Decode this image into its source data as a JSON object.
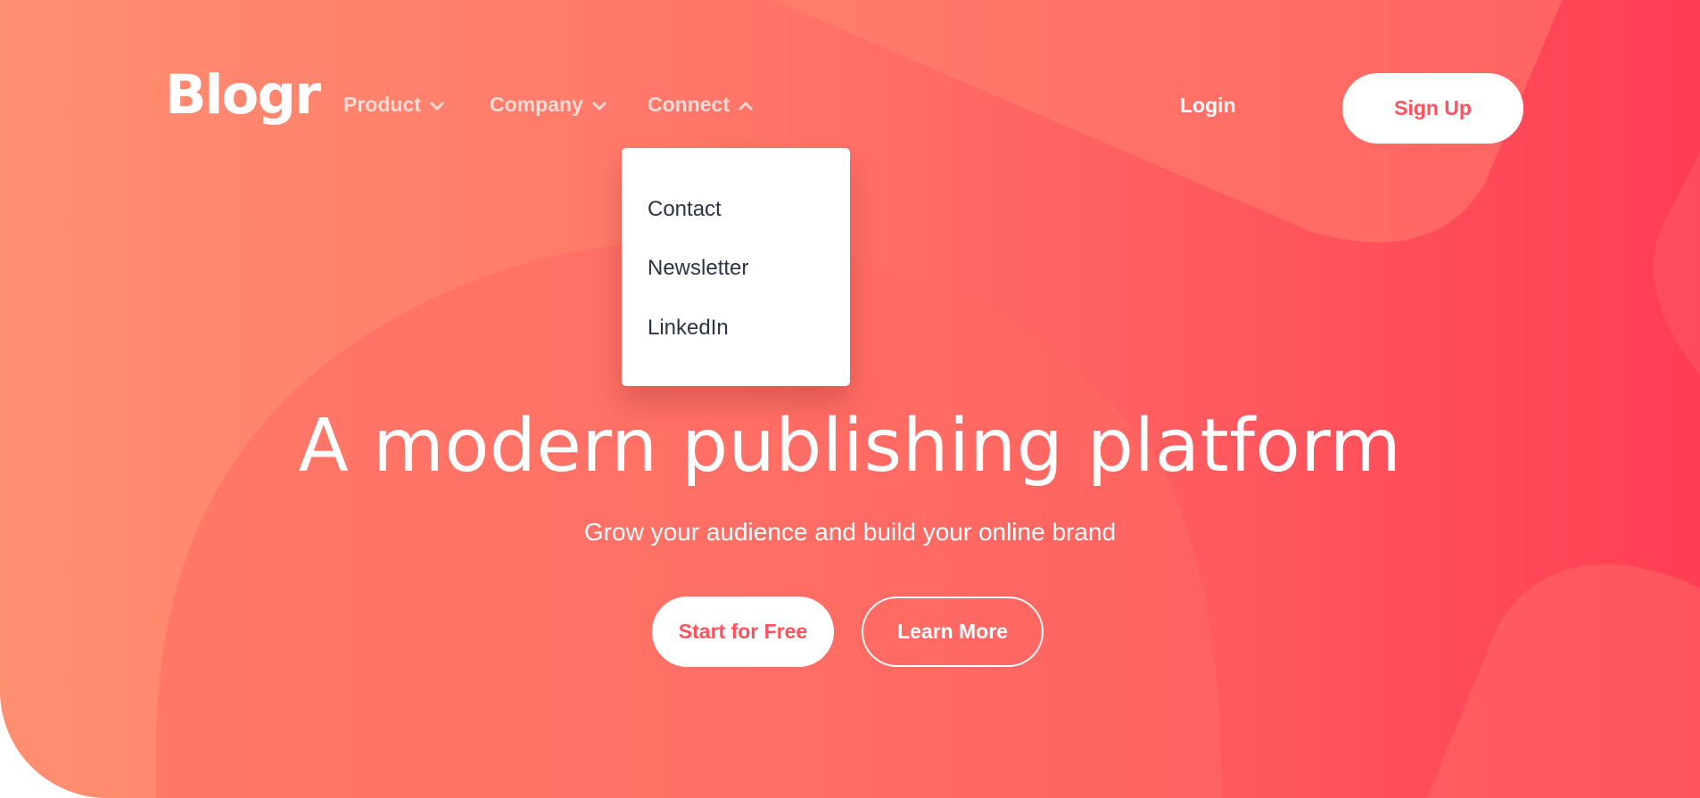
{
  "brand": {
    "logo": "Blogr"
  },
  "nav": {
    "items": [
      {
        "label": "Product",
        "expanded": false
      },
      {
        "label": "Company",
        "expanded": false
      },
      {
        "label": "Connect",
        "expanded": true
      }
    ],
    "login": "Login",
    "signup": "Sign Up"
  },
  "dropdown": {
    "items": [
      "Contact",
      "Newsletter",
      "LinkedIn"
    ]
  },
  "hero": {
    "title": "A modern publishing platform",
    "subtitle": "Grow your audience and build your online brand",
    "primary_cta": "Start for Free",
    "secondary_cta": "Learn More"
  },
  "colors": {
    "gradient_start": "#ff8f70",
    "gradient_end": "#ff3d54",
    "accent": "#ff525c",
    "dropdown_text": "#2b3446",
    "white": "#ffffff"
  },
  "icons": {
    "nav_arrow_down": "chevron-down-icon",
    "nav_arrow_up": "chevron-up-icon"
  }
}
